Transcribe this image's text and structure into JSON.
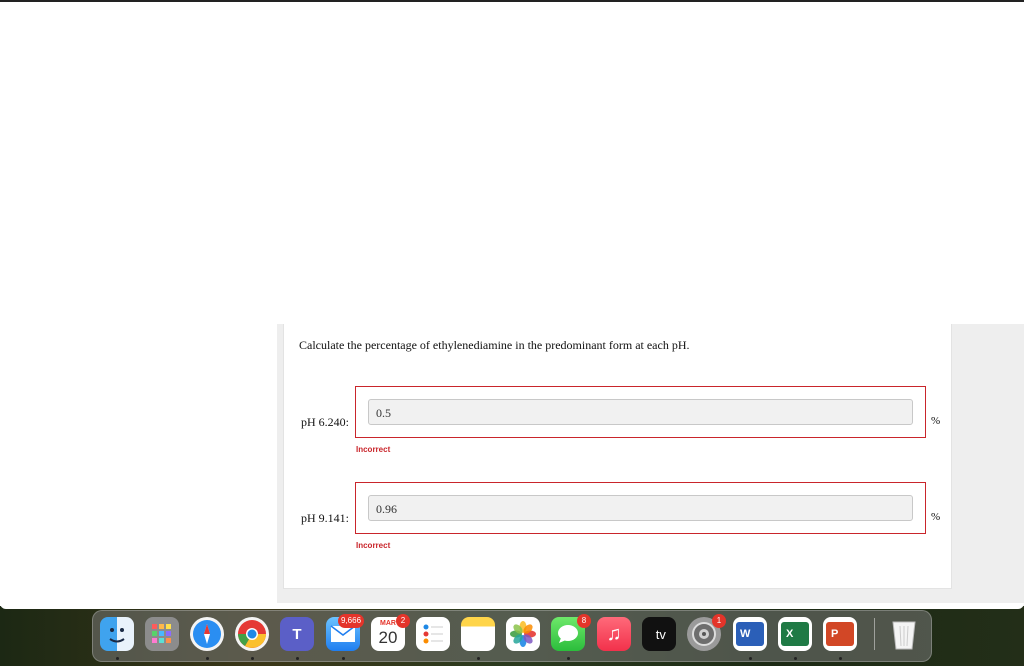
{
  "question": {
    "prompt": "Calculate the percentage of ethylenediamine in the predominant form at each pH.",
    "rows": [
      {
        "label": "pH 6.240:",
        "value": "0.5",
        "unit": "%",
        "status": "Incorrect"
      },
      {
        "label": "pH 9.141:",
        "value": "0.96",
        "unit": "%",
        "status": "Incorrect"
      }
    ]
  },
  "colors": {
    "error": "#c9252b",
    "input_bg": "#f1f1f1"
  },
  "dock": {
    "mail_badge": "9,666",
    "calendar_month": "MAR",
    "calendar_day": "20",
    "calendar_badge": "2",
    "messages_badge": "8",
    "settings_badge": "1",
    "tv_label": " tv",
    "word_letter": "W",
    "excel_letter": "X",
    "powerpoint_letter": "P",
    "teams_letter": "T",
    "items": [
      "finder-icon",
      "launchpad-icon",
      "safari-icon",
      "chrome-icon",
      "teams-icon",
      "mail-icon",
      "calendar-icon",
      "reminders-icon",
      "notes-icon",
      "photos-icon",
      "messages-icon",
      "music-icon",
      "apple-tv-icon",
      "system-settings-icon",
      "word-icon",
      "excel-icon",
      "powerpoint-icon",
      "trash-icon"
    ]
  }
}
